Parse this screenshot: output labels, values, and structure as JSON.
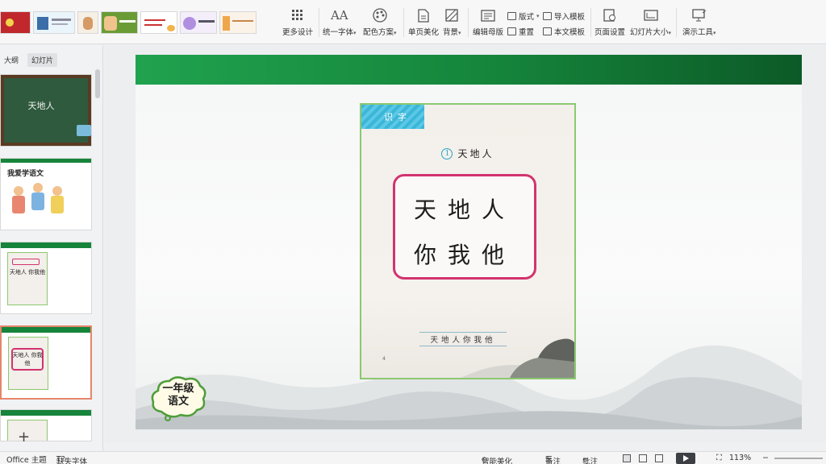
{
  "ribbon": {
    "more_design": "更多设计",
    "unify_font": "统一字体",
    "color_scheme": "配色方案",
    "page_beautify": "单页美化",
    "background": "背景",
    "edit_master": "编辑母版",
    "layout": "版式",
    "reset": "重置",
    "import_template": "导入模板",
    "text_template": "本文模板",
    "page_setup": "页面设置",
    "slide_size": "幻灯片大小",
    "presentation_tools": "演示工具"
  },
  "left_panel": {
    "tab_outline": "大纲",
    "tab_slides": "幻灯片",
    "slide1_title": "天地人",
    "slide2_title": "我爱学语文",
    "slide3_text": "天地人 你我他",
    "slide4_text": "天地人 你我他"
  },
  "slide": {
    "tag": "识字",
    "lesson_number": "1",
    "lesson_title": "天地人",
    "line1": "天地人",
    "line2": "你我他",
    "footer": "天地人你我他",
    "page_number": "4",
    "badge_line1": "一年级",
    "badge_line2": "语文"
  },
  "status": {
    "theme": "Office 主题",
    "missing_font": "缺失字体",
    "smart_beautify": "智能美化",
    "notes": "备注",
    "comments": "批注",
    "zoom": "113%"
  },
  "colors": {
    "green_bar": "#15843b",
    "frame_pink": "#d2336f",
    "tag_blue": "#3ab6d8",
    "selected_slide": "#e5866a"
  }
}
